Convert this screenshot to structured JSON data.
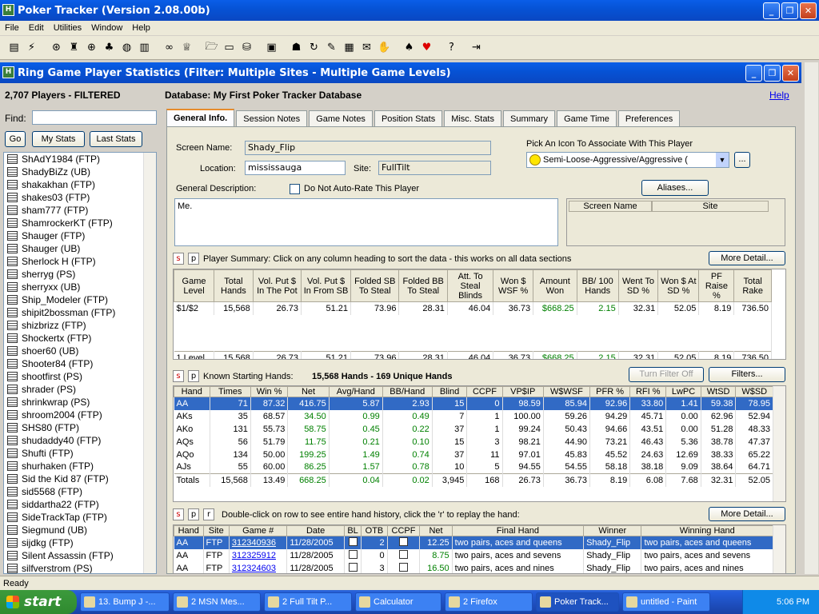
{
  "app": {
    "title": "Poker Tracker (Version 2.08.00b)"
  },
  "menu": [
    "File",
    "Edit",
    "Utilities",
    "Window",
    "Help"
  ],
  "inner": {
    "title": "Ring Game Player Statistics (Filter: Multiple Sites - Multiple Game Levels)",
    "players": "2,707 Players - FILTERED",
    "database": "Database: My First Poker Tracker Database",
    "help": "Help"
  },
  "left": {
    "find_label": "Find:",
    "go": "Go",
    "my_stats": "My Stats",
    "last_stats": "Last Stats",
    "players": [
      "ShAdY1984 (FTP)",
      "ShadyBiZz (UB)",
      "shakakhan (FTP)",
      "shakes03 (FTP)",
      "sham777 (FTP)",
      "ShamrockerKT (FTP)",
      "Shauger (FTP)",
      "Shauger (UB)",
      "Sherlock H (FTP)",
      "sherryg (PS)",
      "sherryxx (UB)",
      "Ship_Modeler (FTP)",
      "shipit2bossman (FTP)",
      "shizbrizz (FTP)",
      "Shockertx (FTP)",
      "shoer60 (UB)",
      "Shooter84 (FTP)",
      "shootfirst (PS)",
      "shrader (PS)",
      "shrinkwrap (PS)",
      "shroom2004 (FTP)",
      "SHS80 (FTP)",
      "shudaddy40 (FTP)",
      "Shufti (FTP)",
      "shurhaken (FTP)",
      "Sid the Kid 87 (FTP)",
      "sid5568 (FTP)",
      "siddartha22 (FTP)",
      "SideTrackTap (FTP)",
      "Siegmund (UB)",
      "sijdkg (FTP)",
      "Silent Assassin (FTP)",
      "silfverstrom (PS)"
    ]
  },
  "tabs": [
    "General Info.",
    "Session Notes",
    "Game Notes",
    "Position Stats",
    "Misc. Stats",
    "Summary",
    "Game Time",
    "Preferences"
  ],
  "general": {
    "screen_name_label": "Screen Name:",
    "screen_name": "Shady_Flip",
    "location_label": "Location:",
    "location": "mississauga",
    "site_label": "Site:",
    "site": "FullTilt",
    "icon_label": "Pick An Icon To Associate With This Player",
    "icon_value": "Semi-Loose-Aggressive/Aggressive (",
    "desc_label": "General Description:",
    "auto_rate": "Do Not Auto-Rate This Player",
    "aliases": "Aliases...",
    "desc": "Me.",
    "alias_cols": [
      "Screen Name",
      "Site"
    ]
  },
  "summary": {
    "caption": "Player Summary: Click on any column heading to sort the data - this works on all data sections",
    "more": "More Detail...",
    "headers": [
      "Game Level",
      "Total Hands",
      "Vol. Put $ In The Pot",
      "Vol. Put $ In From SB",
      "Folded SB To Steal",
      "Folded BB To Steal",
      "Att. To Steal Blinds",
      "Won $ WSF %",
      "Amount Won",
      "BB/ 100 Hands",
      "Went To SD %",
      "Won $ At SD %",
      "PF Raise %",
      "Total Rake"
    ],
    "row": [
      "$1/$2",
      "15,568",
      "26.73",
      "51.21",
      "73.96",
      "28.31",
      "46.04",
      "36.73",
      "$668.25",
      "2.15",
      "32.31",
      "52.05",
      "8.19",
      "736.50"
    ],
    "total": [
      "1 Level",
      "15,568",
      "26.73",
      "51.21",
      "73.96",
      "28.31",
      "46.04",
      "36.73",
      "$668.25",
      "2.15",
      "32.31",
      "52.05",
      "8.19",
      "736.50"
    ]
  },
  "hands": {
    "caption": "Known Starting Hands:",
    "count": "15,568 Hands - 169 Unique Hands",
    "turn_filter": "Turn Filter Off",
    "filters": "Filters...",
    "headers": [
      "Hand",
      "Times",
      "Win %",
      "Net",
      "Avg/Hand",
      "BB/Hand",
      "Blind",
      "CCPF",
      "VP$IP",
      "W$WSF",
      "PFR %",
      "RFI %",
      "LwPC",
      "WtSD",
      "W$SD"
    ],
    "rows": [
      [
        "AA",
        "71",
        "87.32",
        "416.75",
        "5.87",
        "2.93",
        "15",
        "0",
        "98.59",
        "85.94",
        "92.96",
        "33.80",
        "1.41",
        "59.38",
        "78.95"
      ],
      [
        "AKs",
        "35",
        "68.57",
        "34.50",
        "0.99",
        "0.49",
        "7",
        "1",
        "100.00",
        "59.26",
        "94.29",
        "45.71",
        "0.00",
        "62.96",
        "52.94"
      ],
      [
        "AKo",
        "131",
        "55.73",
        "58.75",
        "0.45",
        "0.22",
        "37",
        "1",
        "99.24",
        "50.43",
        "94.66",
        "43.51",
        "0.00",
        "51.28",
        "48.33"
      ],
      [
        "AQs",
        "56",
        "51.79",
        "11.75",
        "0.21",
        "0.10",
        "15",
        "3",
        "98.21",
        "44.90",
        "73.21",
        "46.43",
        "5.36",
        "38.78",
        "47.37"
      ],
      [
        "AQo",
        "134",
        "50.00",
        "199.25",
        "1.49",
        "0.74",
        "37",
        "11",
        "97.01",
        "45.83",
        "45.52",
        "24.63",
        "12.69",
        "38.33",
        "65.22"
      ],
      [
        "AJs",
        "55",
        "60.00",
        "86.25",
        "1.57",
        "0.78",
        "10",
        "5",
        "94.55",
        "54.55",
        "58.18",
        "38.18",
        "9.09",
        "38.64",
        "64.71"
      ]
    ],
    "totals": [
      "Totals",
      "15,568",
      "13.49",
      "668.25",
      "0.04",
      "0.02",
      "3,945",
      "168",
      "26.73",
      "36.73",
      "8.19",
      "6.08",
      "7.68",
      "32.31",
      "52.05"
    ]
  },
  "history": {
    "caption": "Double-click on row to see entire hand history, click the 'r' to replay the hand:",
    "more": "More Detail...",
    "headers": [
      "Hand",
      "Site",
      "Game #",
      "Date",
      "BL",
      "OTB",
      "CCPF",
      "Net",
      "Final Hand",
      "Winner",
      "Winning Hand"
    ],
    "rows": [
      [
        "AA",
        "FTP",
        "312340936",
        "11/28/2005",
        "2",
        "12.25",
        "two pairs, aces and queens",
        "Shady_Flip",
        "two pairs, aces and queens"
      ],
      [
        "AA",
        "FTP",
        "312325912",
        "11/28/2005",
        "0",
        "8.75",
        "two pairs, aces and sevens",
        "Shady_Flip",
        "two pairs, aces and sevens"
      ],
      [
        "AA",
        "FTP",
        "312324603",
        "11/28/2005",
        "3",
        "16.50",
        "two pairs, aces and nines",
        "Shady_Flip",
        "two pairs, aces and nines"
      ]
    ]
  },
  "status": "Ready",
  "taskbar": {
    "start": "start",
    "tasks": [
      "13. Bump J -...",
      "2 MSN Mes...",
      "2 Full Tilt P...",
      "Calculator",
      "2 Firefox",
      "Poker Track...",
      "untitled - Paint"
    ],
    "clock": "5:06 PM"
  }
}
